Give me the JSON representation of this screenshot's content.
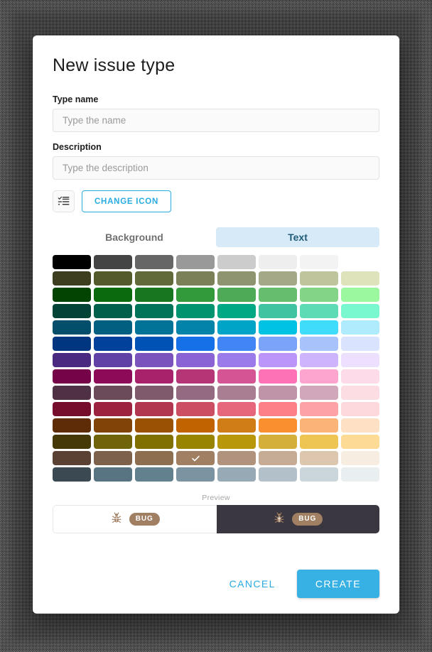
{
  "dialog": {
    "title": "New issue type"
  },
  "form": {
    "type_name": {
      "label": "Type name",
      "placeholder": "Type the name",
      "value": ""
    },
    "description": {
      "label": "Description",
      "placeholder": "Type the description",
      "value": ""
    },
    "icon_chip": "checklist-icon",
    "change_icon_label": "CHANGE ICON"
  },
  "tabs": [
    {
      "label": "Background",
      "active": false
    },
    {
      "label": "Text",
      "active": true
    }
  ],
  "tab_colors": {
    "active_bg": "#d6eaf8",
    "active_text": "#1f5b78",
    "inactive_text": "#6f7072"
  },
  "palette": {
    "columns": 8,
    "rows": 14,
    "selected": {
      "row": 12,
      "col": 3,
      "hex": "#a07f63"
    },
    "swatches": [
      [
        "#000000",
        "#444444",
        "#666666",
        "#999999",
        "#cccccc",
        "#eeeeee",
        "#f3f3f3",
        null
      ],
      [
        "#3d3d1f",
        "#555a2b",
        "#61683a",
        "#7c8058",
        "#8f9470",
        "#a4a887",
        "#c0c49c",
        "#dfe3bb"
      ],
      [
        "#034402",
        "#0a6b0e",
        "#17761f",
        "#329a3b",
        "#4faa58",
        "#66bd6d",
        "#84d488",
        "#9cf89f"
      ],
      [
        "#024537",
        "#01604c",
        "#007458",
        "#009370",
        "#00a883",
        "#3fc3a0",
        "#5ddbb4",
        "#79f7cf"
      ],
      [
        "#024e6b",
        "#015f80",
        "#017396",
        "#0383a8",
        "#00a4c6",
        "#00c2e3",
        "#3fdcfb",
        "#aeecfd"
      ],
      [
        "#003580",
        "#02419b",
        "#0052b4",
        "#1670e8",
        "#4285f4",
        "#7ba3f7",
        "#a8c2fb",
        "#d9e3fd"
      ],
      [
        "#4a2a80",
        "#6141a6",
        "#7a53bd",
        "#8a64d4",
        "#9b7bea",
        "#bb95fa",
        "#cdb4fd",
        "#ece0fe"
      ],
      [
        "#740447",
        "#8d0a58",
        "#a8216b",
        "#b43676",
        "#d35594",
        "#fd72b6",
        "#fda5cf",
        "#fddbe8"
      ],
      [
        "#4f3145",
        "#6b4a59",
        "#7f5a6d",
        "#936a7f",
        "#a97e92",
        "#bf93a8",
        "#d0a7bb",
        "#fbdde3"
      ],
      [
        "#760d2c",
        "#9b2340",
        "#b13650",
        "#cb4e62",
        "#e6677b",
        "#fd8089",
        "#fda3a8",
        "#fdd9dd"
      ],
      [
        "#5e2d07",
        "#824306",
        "#9b5103",
        "#c06300",
        "#d07d18",
        "#f98f2e",
        "#fcb377",
        "#fee1c4"
      ],
      [
        "#443907",
        "#6f640a",
        "#806f01",
        "#998402",
        "#b8970a",
        "#d4b03b",
        "#eec553",
        "#fedb95"
      ],
      [
        "#5b4134",
        "#7e614a",
        "#8d6f50",
        "#a07f63",
        "#b1927c",
        "#c6ab95",
        "#dcc7ae",
        "#f7ede1"
      ],
      [
        "#3a4952",
        "#587381",
        "#63808f",
        "#7c93a1",
        "#96a9b5",
        "#b2c1c9",
        "#cbd6dc",
        "#e9eef1"
      ]
    ]
  },
  "preview": {
    "label": "Preview",
    "badge_text": "BUG",
    "badge_bg": "#a07f63",
    "badge_text_color": "#ffffff",
    "icon": "bug-icon",
    "icon_color": "#a07f63",
    "light_bg": "#ffffff",
    "dark_bg": "#3a3741"
  },
  "footer": {
    "cancel_label": "CANCEL",
    "create_label": "CREATE",
    "accent": "#29abe2"
  }
}
